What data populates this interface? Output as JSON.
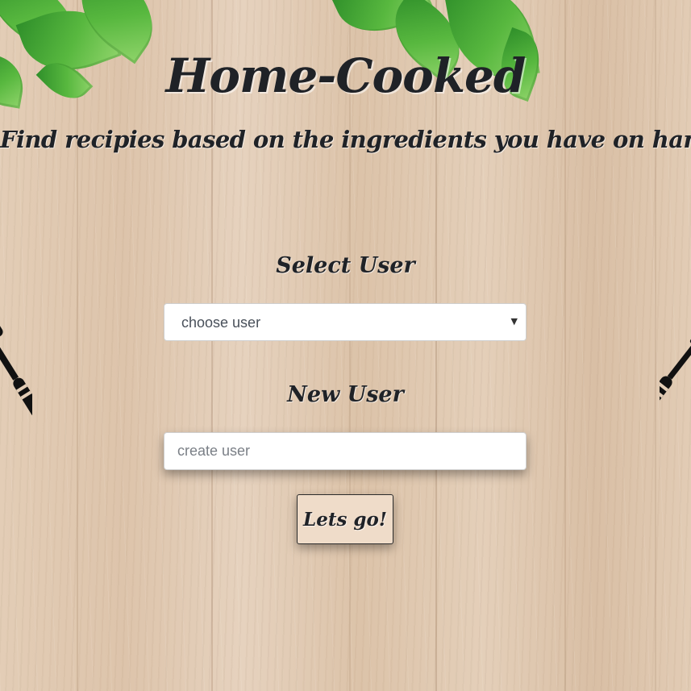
{
  "header": {
    "title": "Home-Cooked",
    "subtitle": "Find recipies based on the ingredients you have on hand"
  },
  "select_user": {
    "label": "Select User",
    "selected": "choose user"
  },
  "new_user": {
    "label": "New User",
    "placeholder": "create user"
  },
  "submit": {
    "label": "Lets go!"
  },
  "icons": {
    "leaves": "parsley-leaves-decoration",
    "left_utensil": "spatula-icon",
    "right_utensil": "fork-icon"
  },
  "colors": {
    "text": "#1f2227",
    "button_bg": "#efdcc9",
    "wood": "#e3cdb6",
    "leaf_green": "#4aa83a"
  }
}
